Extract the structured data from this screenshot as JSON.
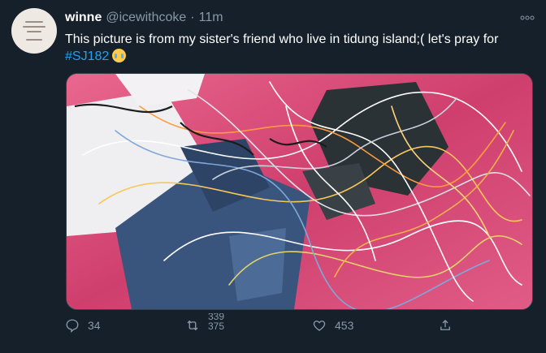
{
  "tweet": {
    "display_name": "winne",
    "handle": "@icewithcoke",
    "separator": "·",
    "time": "11m",
    "more_label": "⚬⚬⚬",
    "text_main": "This picture is from my sister's friend who live in tidung island;( let's pray for",
    "hashtag": "#SJ182",
    "emoji": "crying-face-emoji",
    "media_icon": "debris-photo"
  },
  "actions": {
    "reply": {
      "icon": "reply-icon",
      "count": "34"
    },
    "retweet": {
      "icon": "retweet-icon",
      "count_prev": "339",
      "count": "375"
    },
    "like": {
      "icon": "heart-icon",
      "count": "453"
    },
    "share": {
      "icon": "share-icon"
    }
  },
  "colors": {
    "background": "#15202b",
    "text_secondary": "#8899a6",
    "accent": "#1da1f2"
  }
}
